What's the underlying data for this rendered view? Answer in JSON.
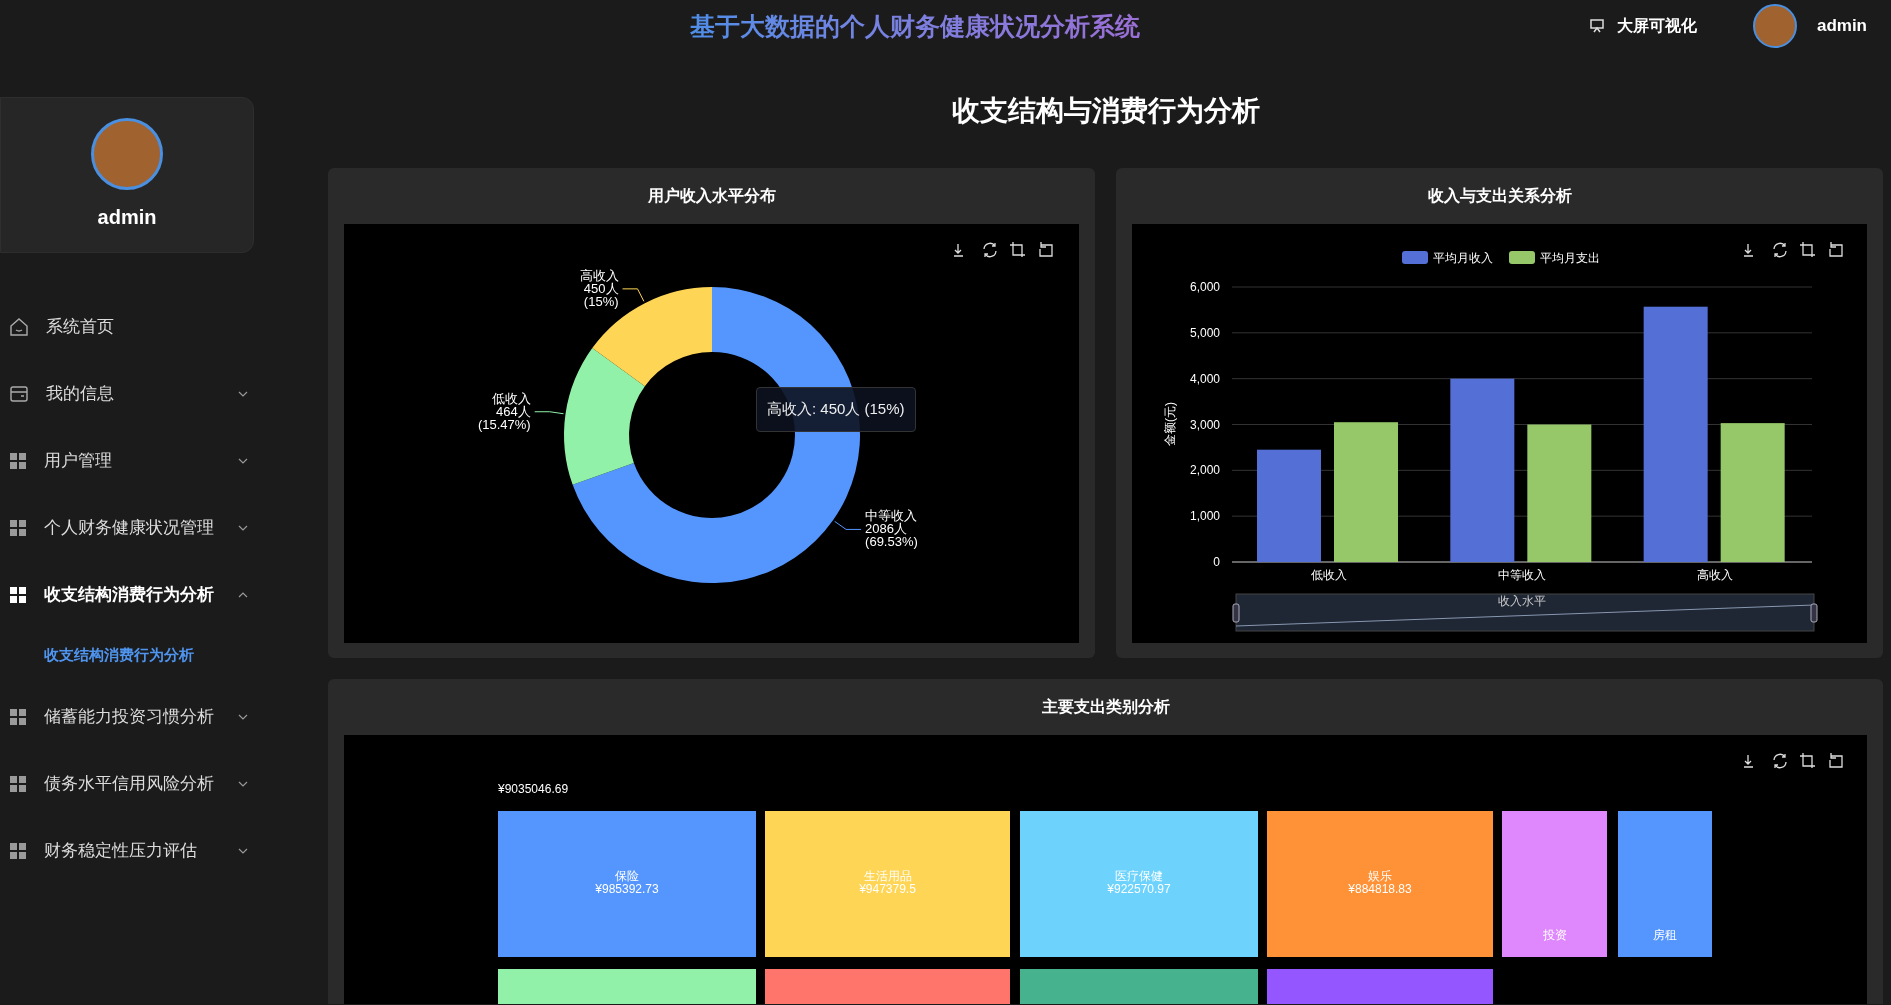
{
  "header": {
    "title": "基于大数据的个人财务健康状况分析系统",
    "screen_link": "大屏可视化",
    "user": "admin"
  },
  "sidebar": {
    "user": "admin",
    "items": [
      {
        "label": "系统首页",
        "kind": "link",
        "selected": false
      },
      {
        "label": "我的信息",
        "kind": "group",
        "selected": false,
        "expanded": false
      },
      {
        "label": "用户管理",
        "kind": "group",
        "selected": false,
        "expanded": false
      },
      {
        "label": "个人财务健康状况管理",
        "kind": "group",
        "selected": false,
        "expanded": false
      },
      {
        "label": "收支结构消费行为分析",
        "kind": "group",
        "selected": true,
        "expanded": true,
        "children": [
          {
            "label": "收支结构消费行为分析",
            "selected": true
          }
        ]
      },
      {
        "label": "储蓄能力投资习惯分析",
        "kind": "group",
        "selected": false,
        "expanded": false
      },
      {
        "label": "债务水平信用风险分析",
        "kind": "group",
        "selected": false,
        "expanded": false
      },
      {
        "label": "财务稳定性压力评估",
        "kind": "group",
        "selected": false,
        "expanded": false
      }
    ]
  },
  "page_title": "收支结构与消费行为分析",
  "panels": [
    {
      "title": "用户收入水平分布",
      "tooltip": "高收入: 450人 (15%)",
      "chart_data": {
        "type": "donut",
        "categories": [
          "中等收入",
          "低收入",
          "高收入"
        ],
        "values": [
          69.53,
          15.47,
          15
        ],
        "colors": [
          "#5596fe",
          "#91f1a8",
          "#ffd555"
        ],
        "value_labels": [
          [
            "2086人",
            "(69.53%)"
          ],
          [
            "464人",
            "(15.47%)"
          ],
          [
            "450人",
            "(15%)"
          ]
        ]
      }
    },
    {
      "title": "收入与支出关系分析",
      "chart_data": {
        "type": "bar",
        "categories": [
          "低收入",
          "中等收入",
          "高收入"
        ],
        "xlabel": "收入水平",
        "ylabel": "金额(元)",
        "ylim": [
          0,
          6000
        ],
        "grid": true,
        "legend": true,
        "yticks": [
          {
            "value": 0,
            "label": "0"
          },
          {
            "value": 1000,
            "label": "1,000"
          },
          {
            "value": 2000,
            "label": "2,000"
          },
          {
            "value": 3000,
            "label": "3,000"
          },
          {
            "value": 4000,
            "label": "4,000"
          },
          {
            "value": 5000,
            "label": "5,000"
          },
          {
            "value": 6000,
            "label": "6,000"
          }
        ],
        "series": [
          {
            "name": "平均月收入",
            "color": "#5470d6",
            "values": [
              2450,
              4000,
              5570
            ]
          },
          {
            "name": "平均月支出",
            "color": "#96c86a",
            "values": [
              3050,
              3000,
              3030
            ]
          }
        ]
      }
    }
  ],
  "treemap": {
    "title": "主要支出类别分析",
    "total": "¥9035046.69",
    "tiles": [
      {
        "label": "保险",
        "value": "¥985392.73",
        "color": "#5596fe"
      },
      {
        "label": "生活用品",
        "value": "¥947379.5",
        "color": "#ffd555"
      },
      {
        "label": "医疗保健",
        "value": "¥922570.97",
        "color": "#6dd3fd"
      },
      {
        "label": "娱乐",
        "value": "¥884818.83",
        "color": "#ff9236"
      },
      {
        "label": "投资",
        "color": "#df87fd"
      },
      {
        "label": "房租",
        "color": "#5596fe"
      },
      {
        "color": "#91f1a8"
      },
      {
        "color": "#ff756b"
      },
      {
        "color": "#46b28e"
      },
      {
        "color": "#9356ff"
      }
    ]
  }
}
